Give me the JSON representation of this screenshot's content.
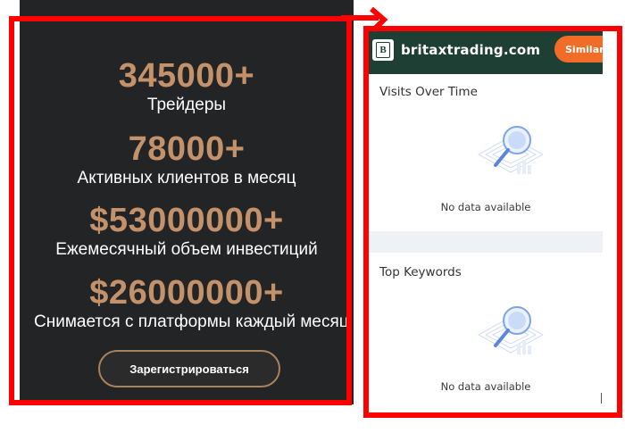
{
  "promo": {
    "stats": [
      {
        "value": "345000+",
        "label": "Трейдеры"
      },
      {
        "value": "78000+",
        "label": "Активных клиентов в месяц"
      },
      {
        "value": "$53000000+",
        "label": "Ежемесячный объем инвестиций"
      },
      {
        "value": "$26000000+",
        "label": "Снимается с платформы каждый месяц"
      }
    ],
    "register_button": "Зарегистрироваться",
    "colors": {
      "background": "#232425",
      "accent": "#c4926a"
    }
  },
  "extension": {
    "logo_letter": "B",
    "site": "britaxtrading.com",
    "similar_button": "Similarweb",
    "sections": [
      {
        "title": "Visits Over Time",
        "empty_text": "No data available"
      },
      {
        "title": "Top Keywords",
        "empty_text": "No data available"
      }
    ],
    "colors": {
      "header": "#1d3f34",
      "button": "#f26b27",
      "annotation": "#ff0000"
    }
  }
}
